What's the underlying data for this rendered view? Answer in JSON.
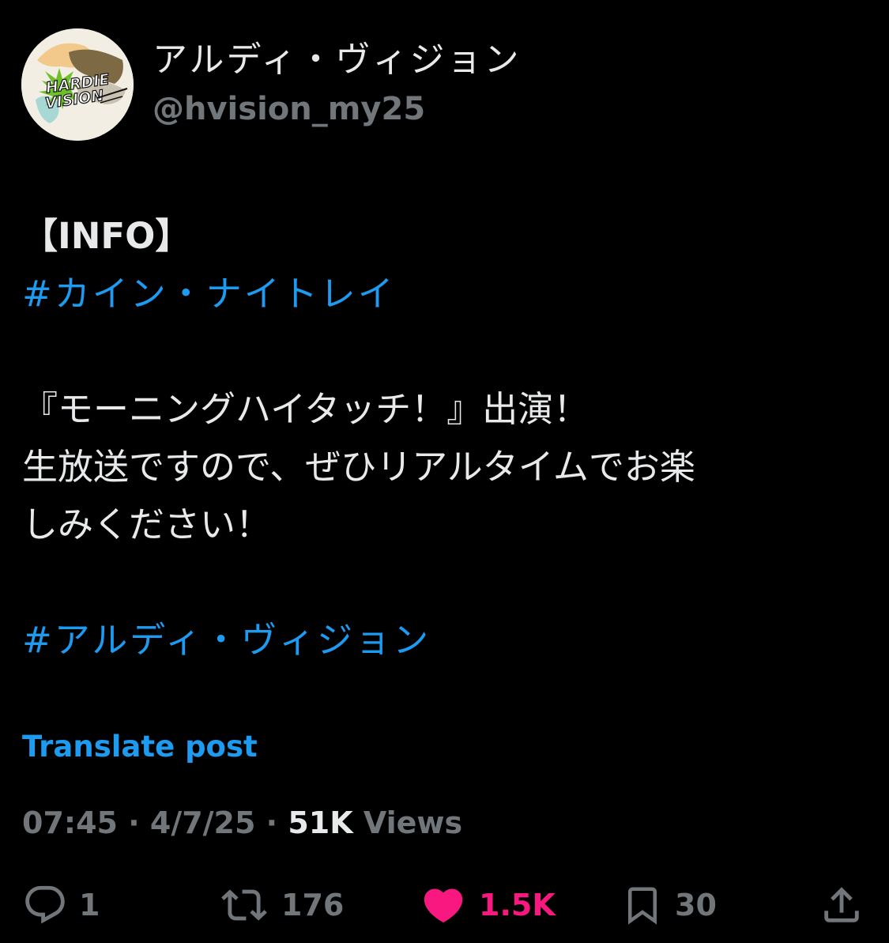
{
  "author": {
    "display_name": "アルディ・ヴィジョン",
    "handle": "@hvision_my25",
    "avatar_logo_text": "HARDIE VISION"
  },
  "post": {
    "lines": [
      {
        "text": "【INFO】",
        "style": "bold"
      },
      {
        "text": "#カイン・ナイトレイ",
        "style": "hashtag"
      },
      {
        "text": "",
        "style": "blank"
      },
      {
        "text": "『モーニングハイタッチ！』出演！",
        "style": "normal"
      },
      {
        "text": "生放送ですので、ぜひリアルタイムでお楽",
        "style": "normal"
      },
      {
        "text": "しみください！",
        "style": "normal"
      },
      {
        "text": "",
        "style": "blank"
      },
      {
        "text": "#アルディ・ヴィジョン",
        "style": "hashtag"
      }
    ],
    "translate_label": "Translate post"
  },
  "meta": {
    "time": "07:45",
    "separator": " · ",
    "date": "4/7/25",
    "views_count": "51K",
    "views_label": " Views"
  },
  "actions": {
    "replies": "1",
    "reposts": "176",
    "likes": "1.5K",
    "bookmarks": "30"
  },
  "colors": {
    "background": "#000000",
    "text": "#e7e9ea",
    "secondary": "#71767b",
    "link": "#1d9bf0",
    "like": "#f91880"
  }
}
